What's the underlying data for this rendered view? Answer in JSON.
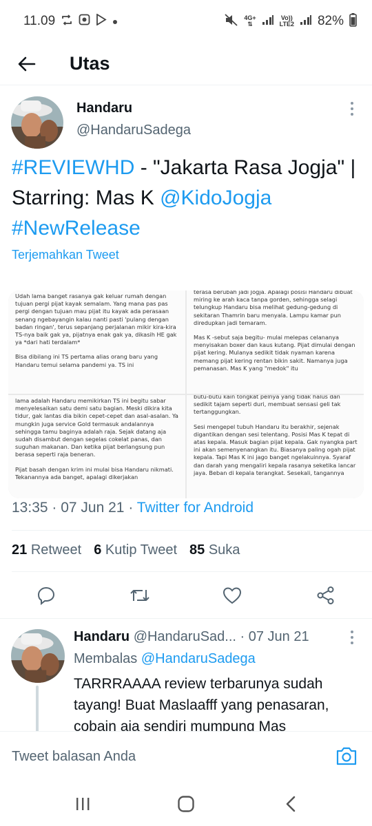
{
  "status_bar": {
    "time": "11.09",
    "net_4g": "4G+",
    "volte_label": "Vo))",
    "lte2_label": "LTE2",
    "battery": "82%"
  },
  "header": {
    "title": "Utas"
  },
  "tweet": {
    "author_name": "Handaru",
    "author_handle": "@HandaruSadega",
    "text_parts": {
      "hashtag_review": "#REVIEWHD",
      "title_part": " - \"Jakarta Rasa Jogja\" | Starring: Mas K ",
      "mention": "@KidoJogja",
      "space": " ",
      "hashtag_new": "#NewRelease"
    },
    "translate_label": "Terjemahkan Tweet",
    "media_text": {
      "tl": [
        "Udah lama banget rasanya gak keluar rumah dengan tujuan pergi pijat kayak semalam. Yang mana pas pas pergi dengan tujuan mau pijat itu kayak ada perasaan senang ngebayangin kalau nanti pasti 'pulang dengan badan ringan', terus sepanjang perjalanan mikir kira-kira TS-nya baik gak ya, pijatnya enak gak ya, dikasih HE gak ya *dari hati terdalam*",
        "Bisa dibilang ini TS pertama alias orang baru yang Handaru temui selama pandemi ya. TS ini"
      ],
      "tr": [
        "terasa berubah jadi Jogja. Apalagi posisi Handaru dibuat miring ke arah kaca tanpa gorden, sehingga selagi telungkup Handaru bisa melihat gedung-gedung di sekitaran Thamrin baru menyala. Lampu kamar pun diredupkan jadi temaram.",
        "Mas K -sebut saja begitu- mulai melepas celananya menyisakan boxer dan kaus kutang. Pijat dimulai dengan pijat kering. Mulanya sedikit tidak nyaman karena memang pijat kering rentan bikin sakit. Namanya juga pemanasan. Mas K yang \"medok\" itu"
      ],
      "bl": [
        "lama adalah Handaru memikirkan TS ini begitu sabar menyelesaikan satu demi satu bagian. Meski dikira kita tidur, gak lantas dia bikin cepet-cepet dan asal-asalan. Ya mungkin juga service Gold termasuk andalannya sehingga tamu baginya adalah raja. Sejak datang aja sudah disambut dengan segelas cokelat panas, dan suguhan makanan. Dan ketika pijat berlangsung pun berasa seperti raja beneran.",
        "Pijat basah dengan krim ini mulai bisa Handaru nikmati. Tekanannya ada banget, apalagi dikerjakan"
      ],
      "br": [
        "butu-butu kain tongkat pelnya yang tidak halus dan sedikit tajam seperti duri, membuat sensasi geli tak tertanggungkan.",
        "Sesi mengepel tubuh Handaru itu berakhir, sejenak digantikan dengan sesi telentang. Posisi Mas K tepat di atas kepala. Masuk bagian pijat kepala. Gak nyangka part ini akan semenyenangkan itu. Biasanya paling ogah pijat kepala. Tapi Mas K ini jago banget ngelakuinnya. Syaraf dan darah yang mengaliri kepala rasanya seketika lancar jaya. Beban di kepala terangkat. Sesekali, tangannya"
      ]
    },
    "time": "13:35",
    "dot": " · ",
    "date": "07 Jun 21",
    "source": "Twitter for Android",
    "stats": {
      "retweet_count": "21",
      "retweet_label": "Retweet",
      "quote_count": "6",
      "quote_label": "Kutip Tweet",
      "like_count": "85",
      "like_label": "Suka"
    }
  },
  "reply": {
    "author_name": "Handaru",
    "author_handle": "@HandaruSad...",
    "dot": " · ",
    "date": "07 Jun 21",
    "replying_label": "Membalas",
    "replying_to": "@HandaruSadega",
    "text": "TARRRAAAA review terbarunya sudah tayang! Buat Maslaafff yang penasaran, cobain aja sendiri mumpung Mas"
  },
  "composer": {
    "placeholder": "Tweet balasan Anda"
  },
  "colors": {
    "link": "#1d9bf0",
    "muted": "#536471",
    "text": "#0f1419"
  }
}
